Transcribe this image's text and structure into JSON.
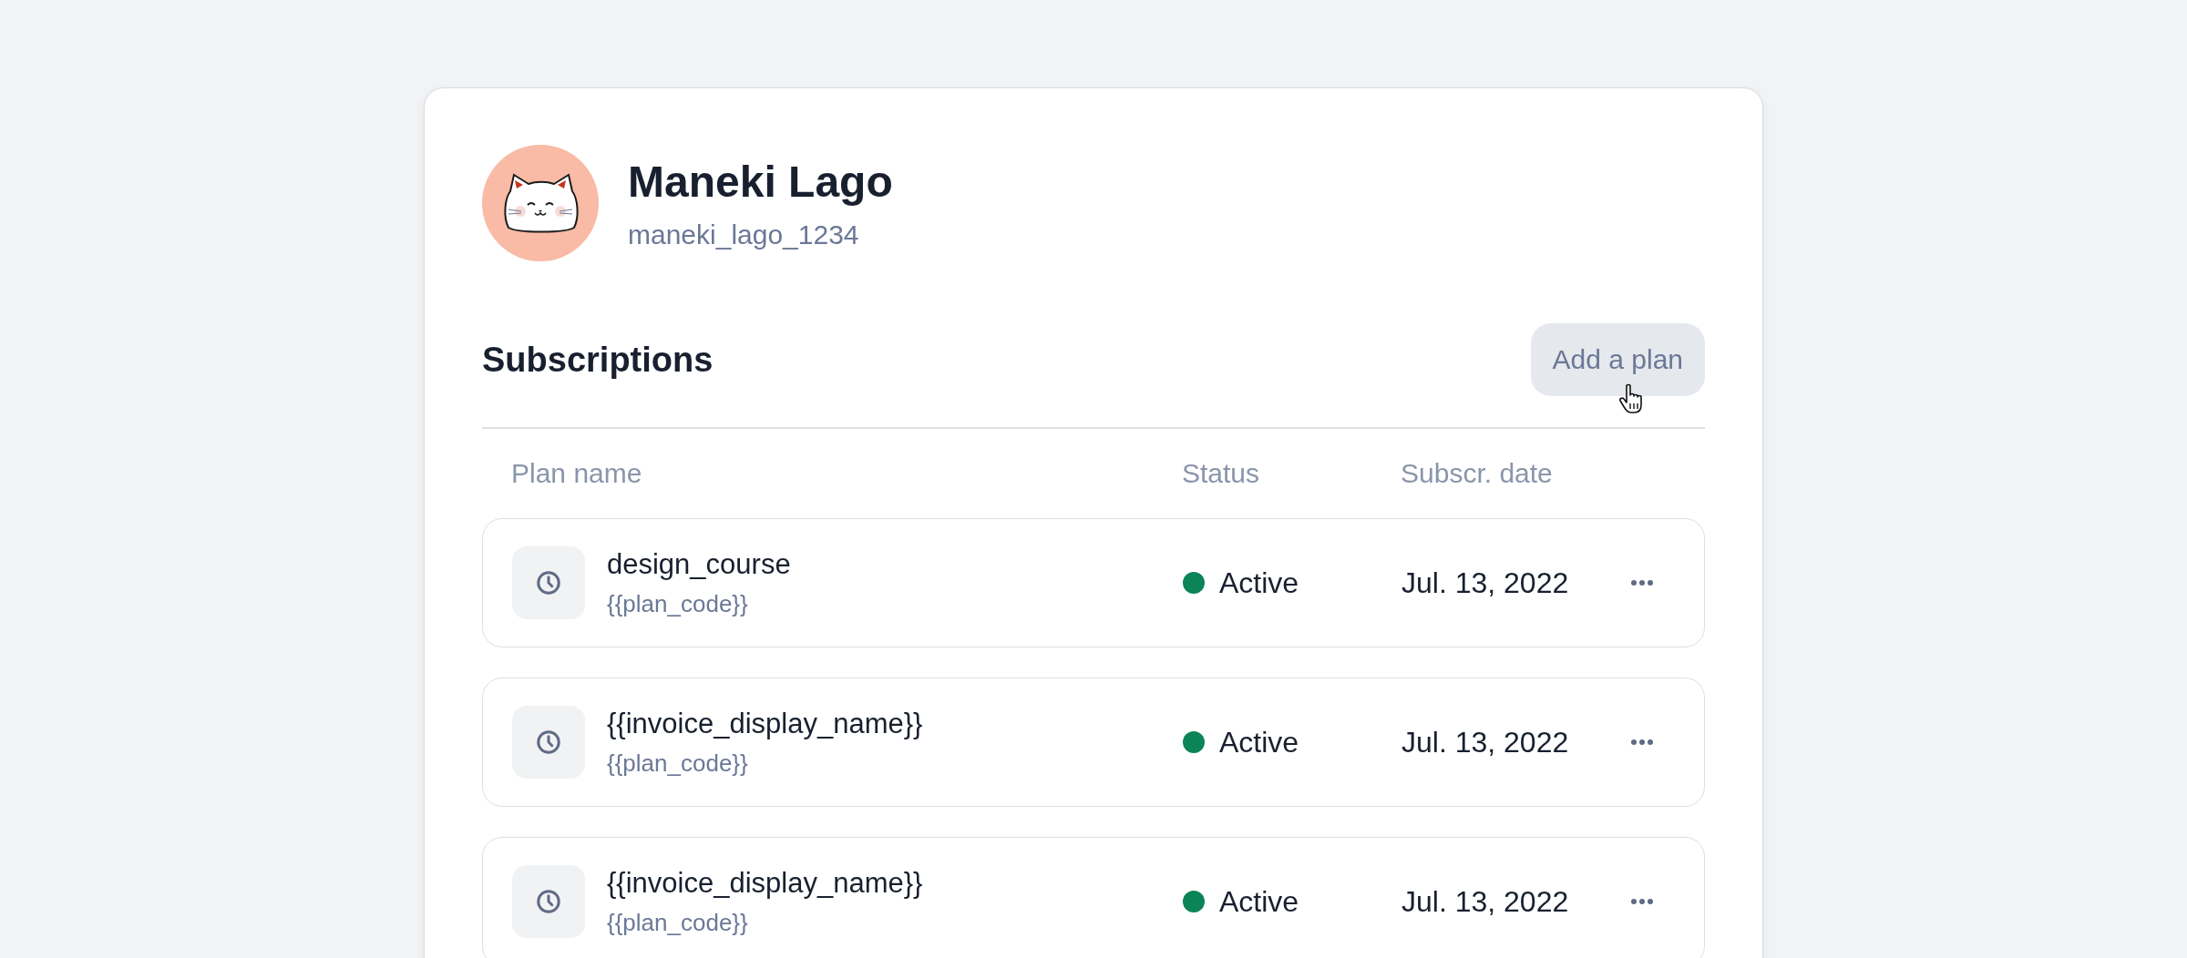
{
  "profile": {
    "name": "Maneki Lago",
    "username": "maneki_lago_1234"
  },
  "section": {
    "title": "Subscriptions",
    "button": "Add a plan"
  },
  "table": {
    "columns": [
      "Plan name",
      "Status",
      "Subscr. date"
    ],
    "rows": [
      {
        "name": "design_course",
        "code": "{{plan_code}}",
        "status": "Active",
        "color": "#0b8457",
        "date": "Jul. 13, 2022"
      },
      {
        "name": "{{invoice_display_name}}",
        "code": "{{plan_code}}",
        "status": "Active",
        "color": "#0b8457",
        "date": "Jul. 13, 2022"
      },
      {
        "name": "{{invoice_display_name}}",
        "code": "{{plan_code}}",
        "status": "Active",
        "color": "#0b8457",
        "date": "Jul. 13, 2022"
      }
    ]
  }
}
